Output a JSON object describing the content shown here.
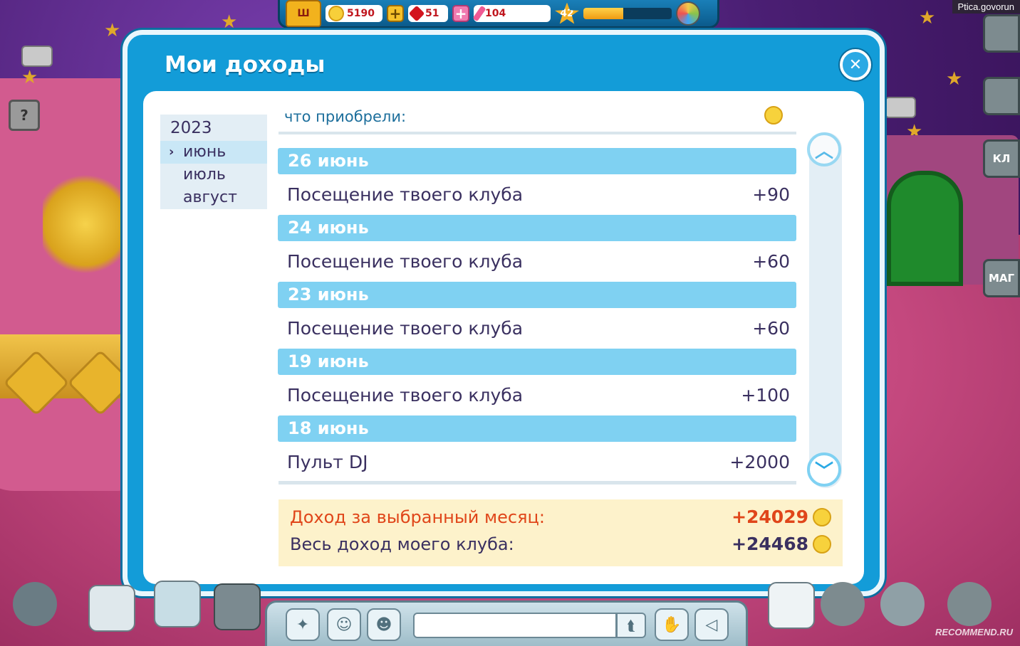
{
  "watermark": {
    "top": "Ptica.govorun",
    "bottom": "RECOMMEND.RU"
  },
  "topbar": {
    "crown_letter": "Ш",
    "coins": "5190",
    "gems": "51",
    "pencils": "104",
    "level": "42",
    "xp_progress": 0.45,
    "help_glyph": "?"
  },
  "background": {
    "help_glyph": "?",
    "right_tab_1": "КЛ",
    "right_tab_2": "МАГ"
  },
  "modal": {
    "title": "Мои доходы",
    "close_glyph": "✕",
    "year": "2023",
    "months": [
      {
        "label": "июнь",
        "selected": true
      },
      {
        "label": "июль",
        "selected": false
      },
      {
        "label": "август",
        "selected": false
      }
    ],
    "column_header": "что приобрели:",
    "entries": [
      {
        "date": "26 июнь",
        "description": "Посещение твоего клуба",
        "amount": "+90"
      },
      {
        "date": "24 июнь",
        "description": "Посещение твоего клуба",
        "amount": "+60"
      },
      {
        "date": "23 июнь",
        "description": "Посещение твоего клуба",
        "amount": "+60"
      },
      {
        "date": "19 июнь",
        "description": "Посещение твоего клуба",
        "amount": "+100"
      },
      {
        "date": "18 июнь",
        "description": "Пульт DJ",
        "amount": "+2000"
      }
    ],
    "totals": {
      "month_label": "Доход за выбранный месяц:",
      "month_value": "+24029",
      "all_label": "Весь доход моего клуба:",
      "all_value": "+24468"
    }
  },
  "colors": {
    "modal_blue": "#139cd8",
    "date_bar": "#7fd1f2",
    "text_main": "#3a3060",
    "month_total": "#e0461a",
    "totals_bg": "#fdf2cb"
  },
  "icons": {
    "chevron": "›",
    "scroll_up": "︿",
    "scroll_down": "﹀",
    "send": "⮬",
    "magic_wand": "✦",
    "smile": "☺",
    "speaker": "◁"
  }
}
